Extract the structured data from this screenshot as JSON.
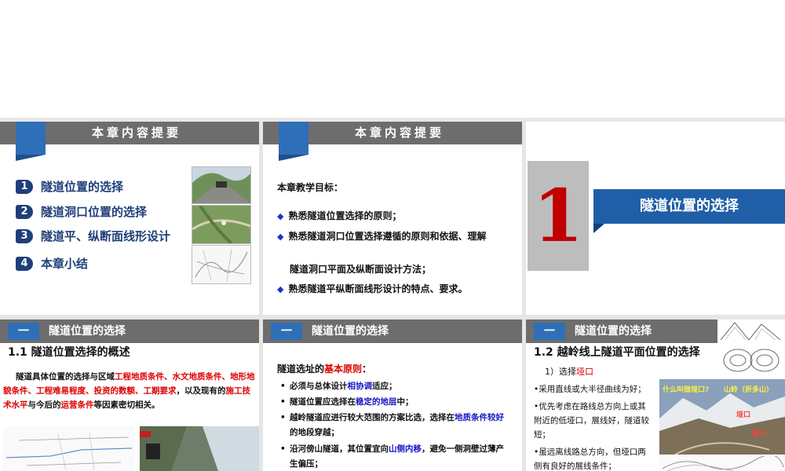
{
  "slide1": {
    "header": "本章内容提要",
    "items": [
      {
        "num": "1",
        "label": "隧道位置的选择"
      },
      {
        "num": "2",
        "label": "隧道洞口位置的选择"
      },
      {
        "num": "3",
        "label": "隧道平、纵断面线形设计"
      },
      {
        "num": "4",
        "label": "本章小结"
      }
    ]
  },
  "slide2": {
    "header": "本章内容提要",
    "objectives_title": "本章教学目标：",
    "objectives": [
      "熟悉隧道位置选择的原则；",
      "熟悉隧道洞口位置选择遵循的原则和依据、理解",
      "熟悉隧道平纵断面线形设计的特点、要求。"
    ],
    "objective_cont": "隧道洞口平面及纵断面设计方法；"
  },
  "slide3": {
    "number": "1",
    "title": "隧道位置的选择"
  },
  "slide4": {
    "tag": "一",
    "header": "隧道位置的选择",
    "heading": "1.1  隧道位置选择的概述",
    "para": {
      "p1": "隧道具体位置的选择与区域",
      "r1": "工程地质条件、水文地质条件、地形地貌条件、工程难易程度、投资的数额、工期要求",
      "p2": "，以及现有的",
      "r2": "施工技术水平",
      "p3": "与今后的",
      "r3": "运营条件",
      "p4": "等因素密切相关。"
    }
  },
  "slide5": {
    "tag": "一",
    "header": "隧道位置的选择",
    "principle_a": "隧道选址的",
    "principle_b": "基本原则",
    "principle_c": "：",
    "b1a": "必须与总体设计",
    "b1b": "相协调",
    "b1c": "适应；",
    "b2a": "隧道位置应选择在",
    "b2b": "稳定的地层",
    "b2c": "中；",
    "b3a": "越岭隧道应进行较大范围的方案比选，选择在",
    "b3b": "地质条件较好",
    "b3c": "的地段穿越；",
    "b4a": "沿河傍山隧道，其位置宜向",
    "b4b": "山侧内移",
    "b4c": "，避免一侧洞壁过薄产生偏压；"
  },
  "slide6": {
    "tag": "一",
    "header": "隧道位置的选择",
    "heading": "1.2  越岭线上隧道平面位置的选择",
    "sub_a": "1）选择",
    "sub_b": "垭口",
    "bullets": [
      "•采用直线或大半径曲线为好；",
      "•优先考虑在路线总方向上或其附近的低垭口，展线好，隧道较短；",
      "•虽远离线路总方向，但垭口两侧有良好的展线条件；"
    ],
    "photo_labels": [
      "什么叫做垭口?",
      "山岭（折多山）",
      "垭口",
      "垭口"
    ]
  },
  "colors": {
    "header_gray": "#6d6d6d",
    "accent_blue": "#2f6fb8",
    "title_navy": "#1f3f7a",
    "red": "#dd0000"
  }
}
